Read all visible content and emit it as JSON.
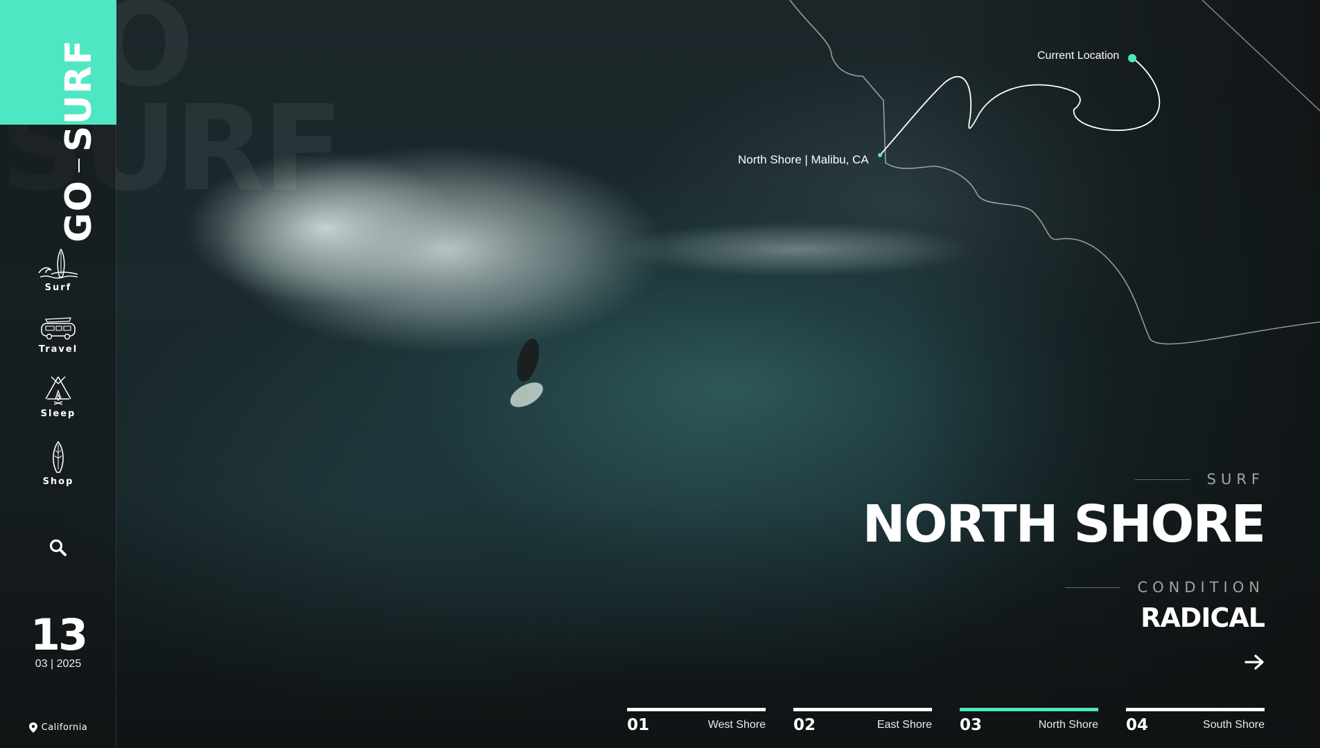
{
  "brand": {
    "go": "GO",
    "surf": "SURF",
    "accent_color": "#4fe6c3"
  },
  "sidebar": {
    "items": [
      {
        "label": "Surf",
        "icon": "surfboard-wave-icon"
      },
      {
        "label": "Travel",
        "icon": "van-icon"
      },
      {
        "label": "Sleep",
        "icon": "tent-icon"
      },
      {
        "label": "Shop",
        "icon": "shop-surfboard-icon"
      }
    ],
    "search_icon": "search-icon"
  },
  "date": {
    "day": "13",
    "month_year": "03 | 2025"
  },
  "location": {
    "label": "California",
    "icon": "map-pin-icon"
  },
  "map": {
    "current_location": "Current Location",
    "spot": "North Shore | Malibu, CA"
  },
  "hero": {
    "kicker": "SURF",
    "title": "NORTH SHORE",
    "condition_label": "CONDITION",
    "condition_value": "RADICAL",
    "next_icon": "arrow-right-icon"
  },
  "tabs": [
    {
      "num": "01",
      "name": "West Shore",
      "active": false
    },
    {
      "num": "02",
      "name": "East Shore",
      "active": false
    },
    {
      "num": "03",
      "name": "North Shore",
      "active": true
    },
    {
      "num": "04",
      "name": "South Shore",
      "active": false
    }
  ]
}
